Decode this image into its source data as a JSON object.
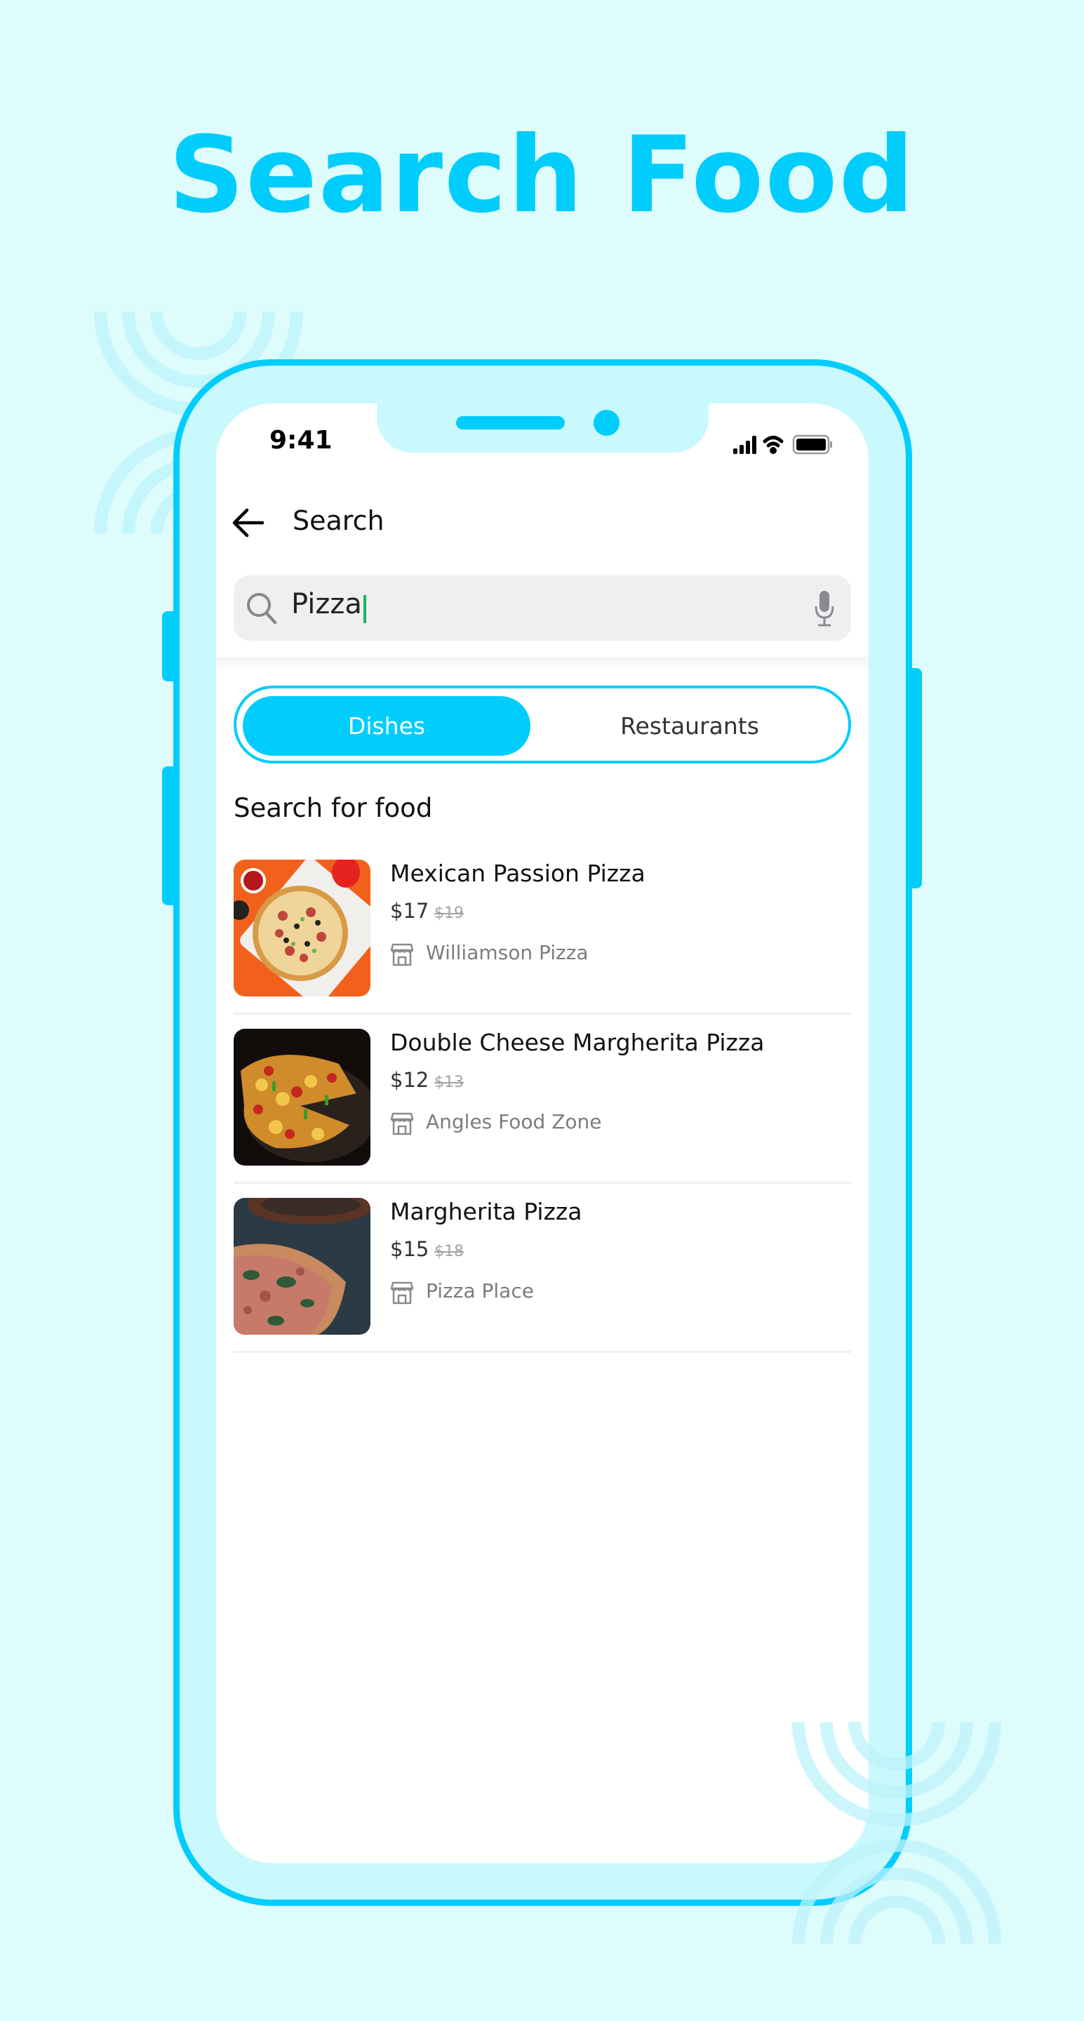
{
  "hero": {
    "title": "Search Food"
  },
  "colors": {
    "accent": "#00cdfc",
    "background": "#dffcfd",
    "phone_fill": "#c9f9fd",
    "caret": "#1db35a"
  },
  "status_bar": {
    "time": "9:41",
    "icons": [
      "cellular-signal-icon",
      "wifi-icon",
      "battery-icon"
    ]
  },
  "header": {
    "back_icon": "arrow-left-icon",
    "title": "Search"
  },
  "search": {
    "value": "Pizza",
    "placeholder": "",
    "leading_icon": "search-icon",
    "trailing_icon": "microphone-icon"
  },
  "tabs": [
    {
      "label": "Dishes",
      "active": true
    },
    {
      "label": "Restaurants",
      "active": false
    }
  ],
  "section": {
    "title": "Search for food"
  },
  "results": [
    {
      "name": "Mexican Passion Pizza",
      "price": "$17",
      "old_price": "$19",
      "restaurant": "Williamson Pizza",
      "restaurant_icon": "store-icon",
      "image": "pizza-photo-orange-table"
    },
    {
      "name": "Double Cheese Margherita Pizza",
      "price": "$12",
      "old_price": "$13",
      "restaurant": "Angles Food Zone",
      "restaurant_icon": "store-icon",
      "image": "pizza-photo-dark-pan"
    },
    {
      "name": "Margherita Pizza",
      "price": "$15",
      "old_price": "$18",
      "restaurant": "Pizza Place",
      "restaurant_icon": "store-icon",
      "image": "pizza-photo-closeup"
    }
  ]
}
